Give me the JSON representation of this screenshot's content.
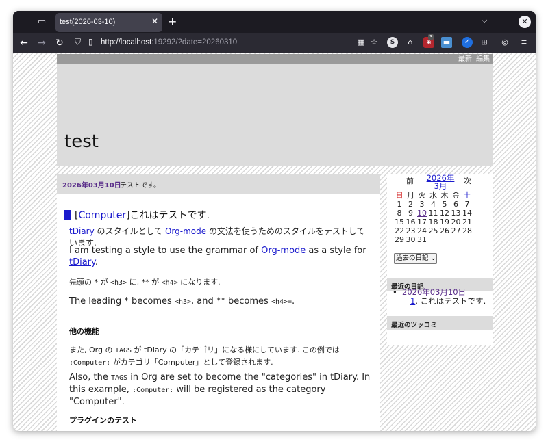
{
  "browser": {
    "tab_title": "test(2026-03-10)",
    "url_host": "http://localhost",
    "url_rest": ":19292/?date=20260310",
    "badge_count": "3"
  },
  "topbar": {
    "latest": "最新",
    "edit": "編集"
  },
  "site": {
    "title": "test"
  },
  "day": {
    "date_link": "2026年03月10日",
    "subtitle": "テストです。"
  },
  "entry": {
    "h3_open": "[",
    "h3_category": "Computer",
    "h3_close": "]これはテストです.",
    "p1": {
      "link1": "tDiary",
      "t1": " のスタイルとして ",
      "link2": "Org-mode",
      "t2": " の文法を使うためのスタイルをテストしています."
    },
    "p2": {
      "t1": "I am testing a style to use the grammar of ",
      "link": "Org-mode",
      "t2": " as a style for ",
      "link2": "tDiary",
      "t3": "."
    },
    "p3": {
      "t1": "先頭の * が ",
      "c1": "<h3>",
      "t2": " に, ** が ",
      "c2": "<h4>",
      "t3": " になります."
    },
    "p4": {
      "t1": "The leading * becomes ",
      "c1": "<h3>",
      "t2": ", and ** becomes ",
      "c2": "<h4>=",
      "t3": "."
    },
    "h4_other": "他の機能",
    "p5": {
      "t1": "また, Org の ",
      "c1": "TAGS",
      "t2": " が tDiary の「カテゴリ」になる様にしています. この例では",
      "c2": ":Computer:",
      "t3": " がカテゴリ「Computer」として登録されます."
    },
    "p6": {
      "t1": "Also, the ",
      "c1": "TAGS",
      "t2": " in Org are set to become the \"categories\" in tDiary. In this example, ",
      "c2": ":Computer:",
      "t3": " will be registered as the category \"Computer\"."
    },
    "h4_plugin": "プラグインのテスト"
  },
  "calendar": {
    "prev": "前",
    "next": "次",
    "year": "2026年",
    "month": "3月",
    "weekdays": [
      "日",
      "月",
      "火",
      "水",
      "木",
      "金",
      "土"
    ],
    "weeks": [
      [
        "1",
        "2",
        "3",
        "4",
        "5",
        "6",
        "7"
      ],
      [
        "8",
        "9",
        "10",
        "11",
        "12",
        "13",
        "14"
      ],
      [
        "15",
        "16",
        "17",
        "18",
        "19",
        "20",
        "21"
      ],
      [
        "22",
        "23",
        "24",
        "25",
        "26",
        "27",
        "28"
      ],
      [
        "29",
        "30",
        "31"
      ]
    ]
  },
  "sidebar": {
    "archive_select": "過去の日記",
    "recent_title": "最近の日記",
    "recent_items": [
      {
        "date": "2026年03月10日",
        "num": "1",
        "title": ". これはテストです."
      }
    ],
    "tsukkomi_title": "最近のツッコミ"
  },
  "icons": [
    "tab-list-icon",
    "close-icon",
    "plus-icon",
    "chevron-down-icon",
    "back-icon",
    "forward-icon",
    "reload-icon",
    "shield-icon",
    "page-icon",
    "grid-icon",
    "star-icon",
    "extension-icon",
    "menu-icon"
  ]
}
